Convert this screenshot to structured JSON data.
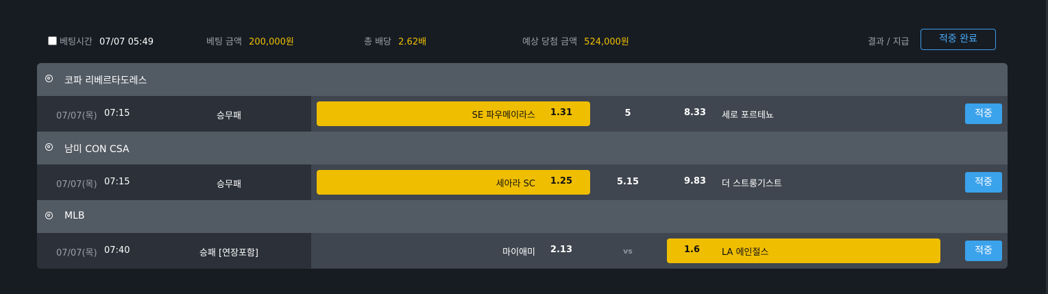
{
  "summary": {
    "bet_time_label": "베팅시간",
    "bet_time_value": "07/07 05:49",
    "bet_amount_label": "베팅 금액",
    "bet_amount_value": "200,000원",
    "total_odds_label": "총 배당",
    "total_odds_value": "2.62배",
    "expected_label": "예상 당첨 금액",
    "expected_value": "524,000원",
    "result_label": "결과 / 지급",
    "done_button": "적중 완료"
  },
  "leagues": [
    {
      "name": "코파 리베르타도레스",
      "icon": "soccer-ball-icon",
      "match": {
        "date": "07/07(목)",
        "time": "07:15",
        "type": "승무패",
        "home": "SE 파우메이라스",
        "home_odds": "1.31",
        "draw": "5",
        "away_odds": "8.33",
        "away": "세로 포르테뇨",
        "selected": "home",
        "result": "적중"
      }
    },
    {
      "name": "남미 CON CSA",
      "icon": "soccer-ball-icon",
      "match": {
        "date": "07/07(목)",
        "time": "07:15",
        "type": "승무패",
        "home": "세아라 SC",
        "home_odds": "1.25",
        "draw": "5.15",
        "away_odds": "9.83",
        "away": "더 스트롱기스트",
        "selected": "home",
        "result": "적중"
      }
    },
    {
      "name": "MLB",
      "icon": "baseball-icon",
      "match": {
        "date": "07/07(목)",
        "time": "07:40",
        "type": "승패 [연장포함]",
        "home": "마이애미",
        "home_odds": "2.13",
        "draw": "vs",
        "away_odds": "1.6",
        "away": "LA 에인절스",
        "selected": "away",
        "result": "적중"
      }
    }
  ],
  "colors": {
    "selected": "#f0be00",
    "accent": "#3ba2ec",
    "gold_text": "#f0c000"
  }
}
